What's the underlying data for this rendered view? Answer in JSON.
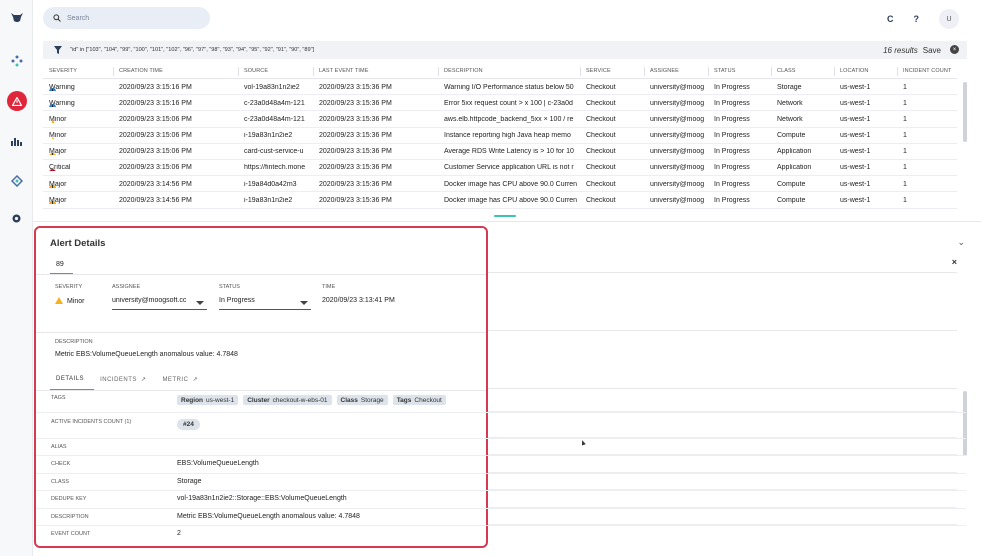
{
  "search": {
    "placeholder": "Search"
  },
  "topbar": {
    "refresh_icon": "C",
    "help_icon": "?",
    "avatar": "U"
  },
  "filter": {
    "query": "\"id\" in [\"103\", \"104\", \"99\", \"100\", \"101\", \"102\", \"96\", \"97\", \"98\", \"93\", \"94\", \"95\", \"92\", \"91\", \"90\", \"89\"]",
    "results": "16 results",
    "save": "Save"
  },
  "grid": {
    "headers": [
      "SEVERITY",
      "CREATION TIME",
      "SOURCE",
      "LAST EVENT TIME",
      "DESCRIPTION",
      "SERVICE",
      "ASSIGNEE",
      "STATUS",
      "CLASS",
      "LOCATION",
      "INCIDENT COUNT"
    ],
    "rows": [
      [
        "Warning",
        "2020/09/23 3:15:16 PM",
        "vol-19a83n1n2ie2",
        "2020/09/23 3:15:36 PM",
        "Warning I/O Performance status below 50",
        "Checkout",
        "university@moog",
        "In Progress",
        "Storage",
        "us-west-1",
        "1"
      ],
      [
        "Warning",
        "2020/09/23 3:15:16 PM",
        "c-23a0d48a4m-121",
        "2020/09/23 3:15:36 PM",
        "Error 5xx request count > x 100 | c-23a0d",
        "Checkout",
        "university@moog",
        "In Progress",
        "Network",
        "us-west-1",
        "1"
      ],
      [
        "Minor",
        "2020/09/23 3:15:06 PM",
        "c-23a0d48a4m-121",
        "2020/09/23 3:15:36 PM",
        "aws.elb.httpcode_backend_5xx × 100 / re",
        "Checkout",
        "university@moog",
        "In Progress",
        "Network",
        "us-west-1",
        "1"
      ],
      [
        "Minor",
        "2020/09/23 3:15:06 PM",
        "i-19a83n1n2ie2",
        "2020/09/23 3:15:36 PM",
        "Instance reporting high Java heap memo",
        "Checkout",
        "university@moog",
        "In Progress",
        "Compute",
        "us-west-1",
        "1"
      ],
      [
        "Major",
        "2020/09/23 3:15:06 PM",
        "card-cust-service-u",
        "2020/09/23 3:15:36 PM",
        "Average RDS Write Latency is > 10 for 10",
        "Checkout",
        "university@moog",
        "In Progress",
        "Application",
        "us-west-1",
        "1"
      ],
      [
        "Critical",
        "2020/09/23 3:15:06 PM",
        "https://fintech.mone",
        "2020/09/23 3:15:36 PM",
        "Customer Service application URL is not r",
        "Checkout",
        "university@moog",
        "In Progress",
        "Application",
        "us-west-1",
        "1"
      ],
      [
        "Major",
        "2020/09/23 3:14:56 PM",
        "i-19a84d0a42m3",
        "2020/09/23 3:15:36 PM",
        "Docker image has CPU above 90.0 Curren",
        "Checkout",
        "university@moog",
        "In Progress",
        "Compute",
        "us-west-1",
        "1"
      ],
      [
        "Major",
        "2020/09/23 3:14:56 PM",
        "i-19a83n1n2ie2",
        "2020/09/23 3:15:36 PM",
        "Docker image has CPU above 90.0 Curren",
        "Checkout",
        "university@moog",
        "In Progress",
        "Compute",
        "us-west-1",
        "1"
      ]
    ]
  },
  "severity_colors": {
    "Warning": "#2f7fd0",
    "Minor": "#f5b21b",
    "Major": "#f2a21b",
    "Critical": "#d8283f"
  },
  "details": {
    "title": "Alert Details",
    "tab_id": "89",
    "severity_label": "SEVERITY",
    "severity_value": "Minor",
    "assignee_label": "ASSIGNEE",
    "assignee_value": "university@moogsoft.cc",
    "status_label": "STATUS",
    "status_value": "In Progress",
    "time_label": "TIME",
    "time_value": "2020/09/23 3:13:41 PM",
    "description_label": "DESCRIPTION",
    "description_value": "Metric EBS:VolumeQueueLength anomalous value: 4.7848",
    "tabs": [
      "DETAILS",
      "INCIDENTS",
      "METRIC"
    ],
    "tags_label": "TAGS",
    "tags": [
      {
        "k": "Region",
        "v": "us-west-1"
      },
      {
        "k": "Cluster",
        "v": "checkout-w-ebs-01"
      },
      {
        "k": "Class",
        "v": "Storage"
      },
      {
        "k": "Tags",
        "v": "Checkout"
      }
    ],
    "active_incidents_label": "ACTIVE INCIDENTS COUNT (1)",
    "active_incident": "#24",
    "alias_label": "ALIAS",
    "check_label": "CHECK",
    "check_value": "EBS:VolumeQueueLength",
    "class_label": "CLASS",
    "class_value": "Storage",
    "dedupe_label": "DEDUPE KEY",
    "dedupe_value": "vol-19a83n1n2ie2::Storage::EBS:VolumeQueueLength",
    "desc2_label": "DESCRIPTION",
    "desc2_value": "Metric EBS:VolumeQueueLength anomalous value: 4.7848",
    "event_count_label": "EVENT COUNT",
    "event_count_value": "2"
  }
}
